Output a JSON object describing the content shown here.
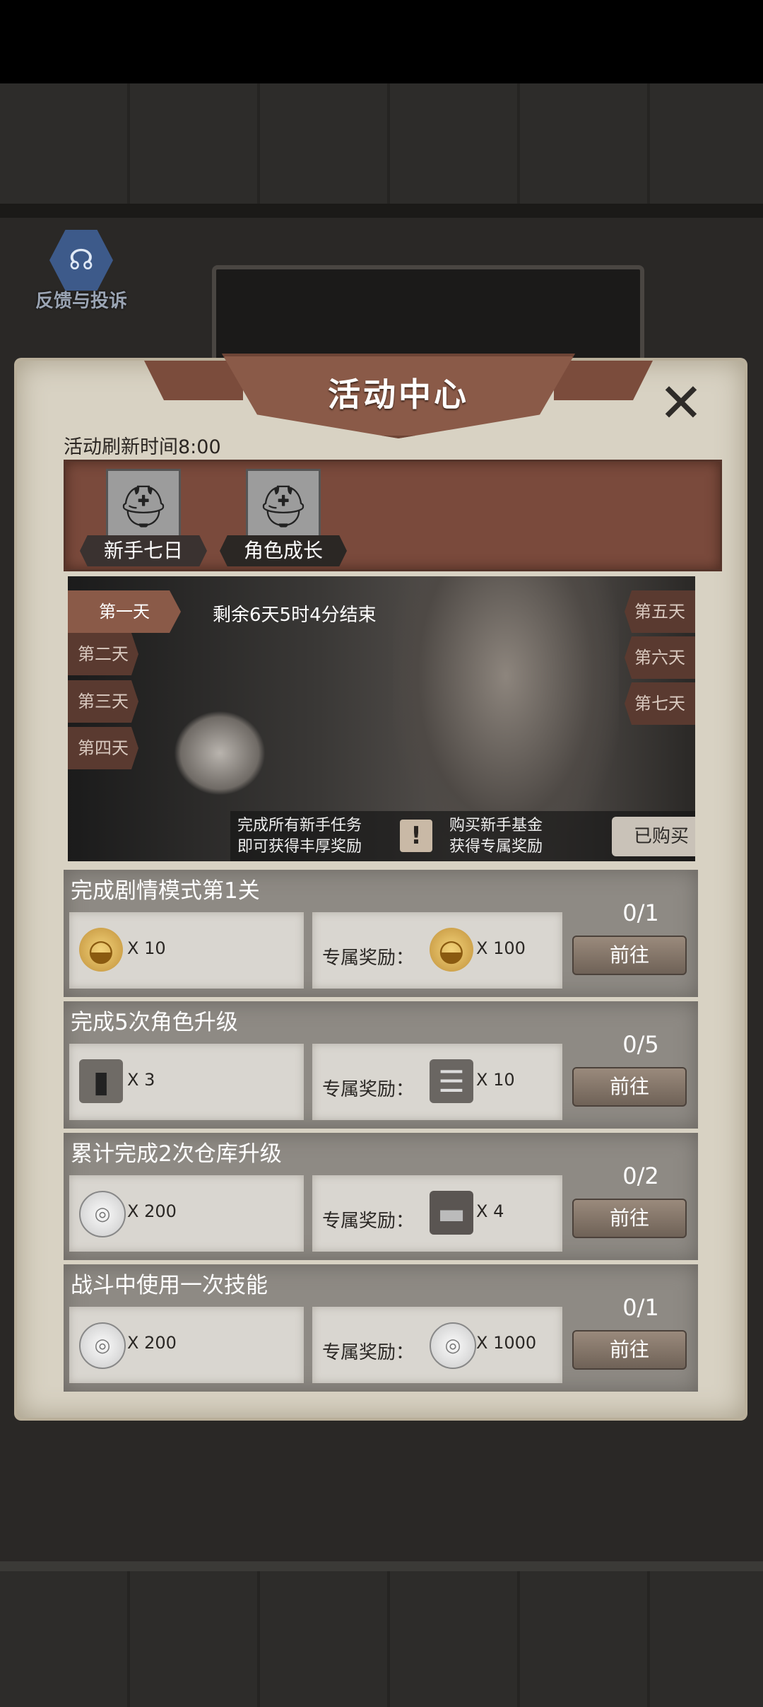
{
  "feedback": {
    "label": "反馈与投诉"
  },
  "dialog": {
    "title": "活动中心",
    "close": "✕",
    "refresh_time": "活动刷新时间8:00"
  },
  "tabs": [
    {
      "label": "新手七日",
      "icon": "helmet-icon"
    },
    {
      "label": "角色成长",
      "icon": "helmet-icon"
    }
  ],
  "hero": {
    "countdown": "剩余6天5时4分结束",
    "days_left": [
      "第一天",
      "第二天",
      "第三天",
      "第四天"
    ],
    "days_right": [
      "第五天",
      "第六天",
      "第七天"
    ],
    "info1_line1": "完成所有新手任务",
    "info1_line2": "即可获得丰厚奖励",
    "info2_line1": "购买新手基金",
    "info2_line2": "获得专属奖励",
    "warn": "!",
    "bought_button": "已购买"
  },
  "quests": [
    {
      "title": "完成剧情模式第1关",
      "base_qty": "X 10",
      "special_label": "专属奖励：",
      "special_qty": "X 100",
      "progress": "0/1",
      "button": "前往"
    },
    {
      "title": "完成5次角色升级",
      "base_qty": "X 3",
      "special_label": "专属奖励：",
      "special_qty": "X 10",
      "progress": "0/5",
      "button": "前往"
    },
    {
      "title": "累计完成2次仓库升级",
      "base_qty": "X 200",
      "special_label": "专属奖励：",
      "special_qty": "X 4",
      "progress": "0/2",
      "button": "前往"
    },
    {
      "title": "战斗中使用一次技能",
      "base_qty": "X 200",
      "special_label": "专属奖励：",
      "special_qty": "X 1000",
      "progress": "0/1",
      "button": "前往"
    }
  ]
}
